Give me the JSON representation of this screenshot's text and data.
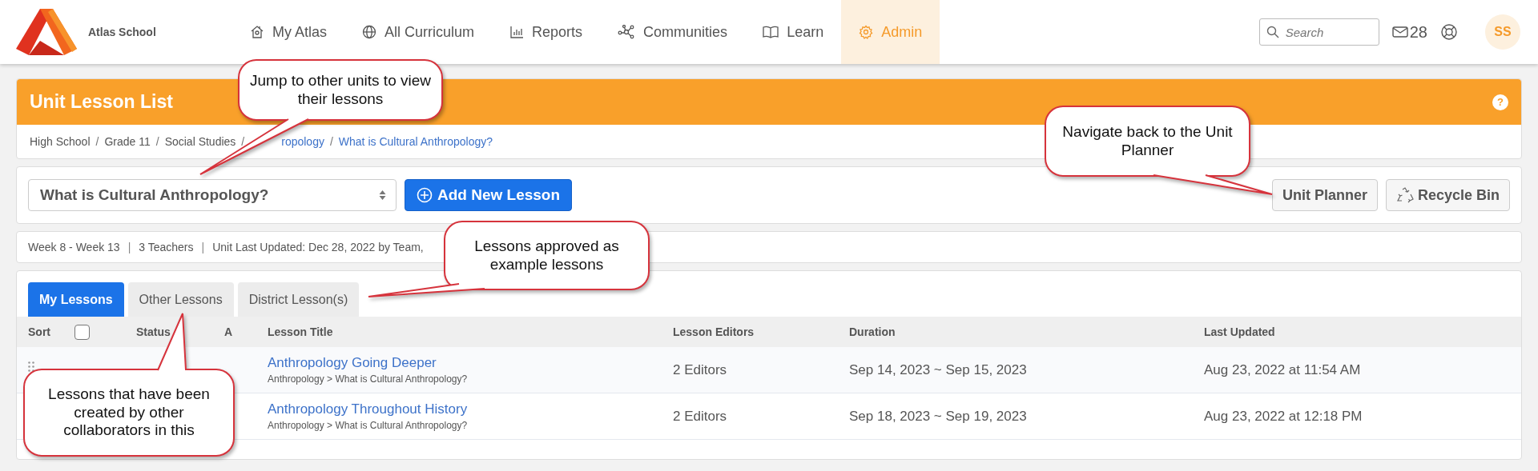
{
  "header": {
    "school_name": "Atlas School",
    "nav": [
      {
        "label": "My Atlas",
        "selected": false
      },
      {
        "label": "All Curriculum",
        "selected": false
      },
      {
        "label": "Reports",
        "selected": false
      },
      {
        "label": "Communities",
        "selected": false
      },
      {
        "label": "Learn",
        "selected": false
      },
      {
        "label": "Admin",
        "selected": true
      }
    ],
    "search": {
      "placeholder": "Search"
    },
    "message_count": "28",
    "avatar": "SS"
  },
  "page": {
    "title": "Unit Lesson List",
    "help": "?",
    "breadcrumbs": [
      {
        "label": "High School",
        "link": false
      },
      {
        "separator": "/",
        "label": "Grade 11",
        "link": false
      },
      {
        "separator": "/",
        "label": "Social Studies",
        "link": false
      },
      {
        "separator": "/",
        "label": "ropology",
        "link": true
      },
      {
        "separator": "/",
        "label": "What is Cultural Anthropology?",
        "link": true
      }
    ]
  },
  "toolbar": {
    "unit_select": "What is Cultural Anthropology?",
    "add_button": "Add New Lesson",
    "unit_planner_button": "Unit Planner",
    "recycle_button": "Recycle Bin"
  },
  "info": [
    {
      "text": "Week 8 - Week 13"
    },
    {
      "separator": "|",
      "text": "3 Teachers"
    },
    {
      "separator": "|",
      "text": "Unit Last Updated: Dec 28, 2022 by Team,"
    }
  ],
  "tabs": [
    {
      "label": "My Lessons",
      "selected": true
    },
    {
      "label": "Other Lessons",
      "selected": false
    },
    {
      "label": "District Lesson(s)",
      "selected": false
    }
  ],
  "table": {
    "columns": [
      "Sort",
      "Status",
      "A",
      "Lesson Title",
      "Lesson Editors",
      "Duration",
      "Last Updated"
    ],
    "header_checked": false,
    "rows": [
      {
        "title": "Anthropology Going Deeper",
        "path": "Anthropology > What is Cultural Anthropology?",
        "editors": "2 Editors",
        "duration": "Sep 14, 2023 ~ Sep 15, 2023",
        "updated": "Aug 23, 2022 at 11:54 AM"
      },
      {
        "title": "Anthropology Throughout History",
        "path": "Anthropology > What is Cultural Anthropology?",
        "editors": "2 Editors",
        "duration": "Sep 18, 2023 ~ Sep 19, 2023",
        "updated": "Aug 23, 2022 at 12:18 PM"
      }
    ]
  },
  "callouts": [
    "Jump to other units to view their lessons",
    "Navigate back to the Unit Planner",
    "Lessons approved as example lessons",
    "Lessons that have been created by other collaborators in this"
  ]
}
